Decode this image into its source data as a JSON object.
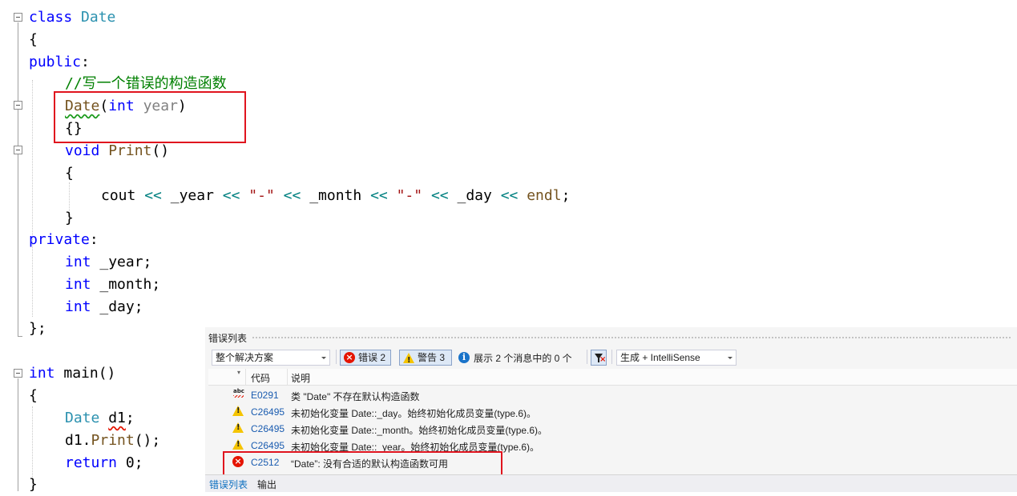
{
  "editor": {
    "lines": {
      "l1": {
        "kw": "class",
        "name": "Date"
      },
      "l2": "{",
      "l3": {
        "kw": "public",
        "punct": ":"
      },
      "l4": "//写一个错误的构造函数",
      "l5": {
        "name": "Date",
        "paren_open": "(",
        "type": "int",
        "param": "year",
        "paren_close": ")"
      },
      "l6": "{}",
      "l7": {
        "type": "void",
        "name": "Print",
        "parens": "()"
      },
      "l8": "{",
      "l9": {
        "cout": "cout",
        "op": "<<",
        "year": "_year",
        "dash": "\"-\"",
        "month": "_month",
        "day": "_day",
        "endl": "endl",
        "semi": ";"
      },
      "l10": "}",
      "l11": {
        "kw": "private",
        "punct": ":"
      },
      "l12": {
        "type": "int",
        "name": "_year;"
      },
      "l13": {
        "type": "int",
        "name": "_month;"
      },
      "l14": {
        "type": "int",
        "name": "_day;"
      },
      "l15": "};",
      "l16": {
        "type": "int",
        "name": "main",
        "parens": "()"
      },
      "l17": "{",
      "l18": {
        "type": "Date",
        "name": "d1",
        "semi": ";"
      },
      "l19": {
        "obj": "d1.",
        "name": "Print",
        "rest": "();"
      },
      "l20": {
        "kw": "return",
        "rest": " 0;"
      },
      "l21": "}"
    }
  },
  "error_panel": {
    "title": "错误列表",
    "scope_select": "整个解决方案",
    "errors_button": "错误 2",
    "warnings_button": "警告 3",
    "messages_button": "展示 2 个消息中的 0 个",
    "source_select": "生成 + IntelliSense",
    "columns": {
      "code": "代码",
      "description": "说明"
    },
    "rows": [
      {
        "severity": "intellisense-error",
        "code": "E0291",
        "description": "类 \"Date\" 不存在默认构造函数"
      },
      {
        "severity": "warning",
        "code": "C26495",
        "description": "未初始化变量 Date::_day。始终初始化成员变量(type.6)。"
      },
      {
        "severity": "warning",
        "code": "C26495",
        "description": "未初始化变量 Date::_month。始终初始化成员变量(type.6)。"
      },
      {
        "severity": "warning",
        "code": "C26495",
        "description": "未初始化变量 Date::_year。始终初始化成员变量(type.6)。"
      },
      {
        "severity": "error",
        "code": "C2512",
        "description": "“Date”: 没有合适的默认构造函数可用"
      }
    ],
    "tabs": {
      "error_list": "错误列表",
      "output": "输出"
    }
  },
  "colors": {
    "keyword": "#0000ff",
    "class_name": "#2b91af",
    "comment": "#008000",
    "operator": "#008080",
    "string": "#a31515",
    "highlight_box": "#e0141e",
    "error_icon": "#e51400",
    "warning_icon": "#f5c400"
  }
}
